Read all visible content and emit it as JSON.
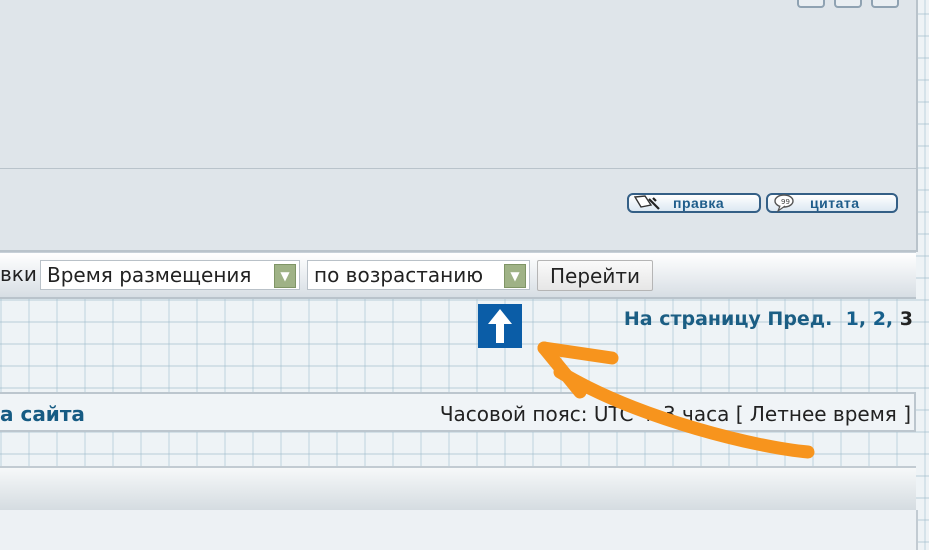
{
  "post": {
    "edit_label": "правка",
    "quote_label": "цитата"
  },
  "sort_bar": {
    "prefix_partial": "вки",
    "sort_field": "Время размещения",
    "sort_order": "по возрастанию",
    "go_label": "Перейти"
  },
  "pagination": {
    "label": "На страницу Пред.",
    "pages": [
      "1",
      "2",
      "3"
    ],
    "current": "3"
  },
  "footer": {
    "site_link_partial": "а сайта",
    "timezone_text": "Часовой пояс: UTC + 3 часа [ Летнее время ]"
  },
  "colors": {
    "accent": "#1b5e84",
    "annotation_arrow": "#f7941d",
    "top_button": "#0b5da7"
  },
  "icons": {
    "edit": "edit-pencil-icon",
    "quote": "speech-bubble-icon",
    "dropdown": "chevron-down-icon",
    "top": "arrow-up-icon"
  }
}
